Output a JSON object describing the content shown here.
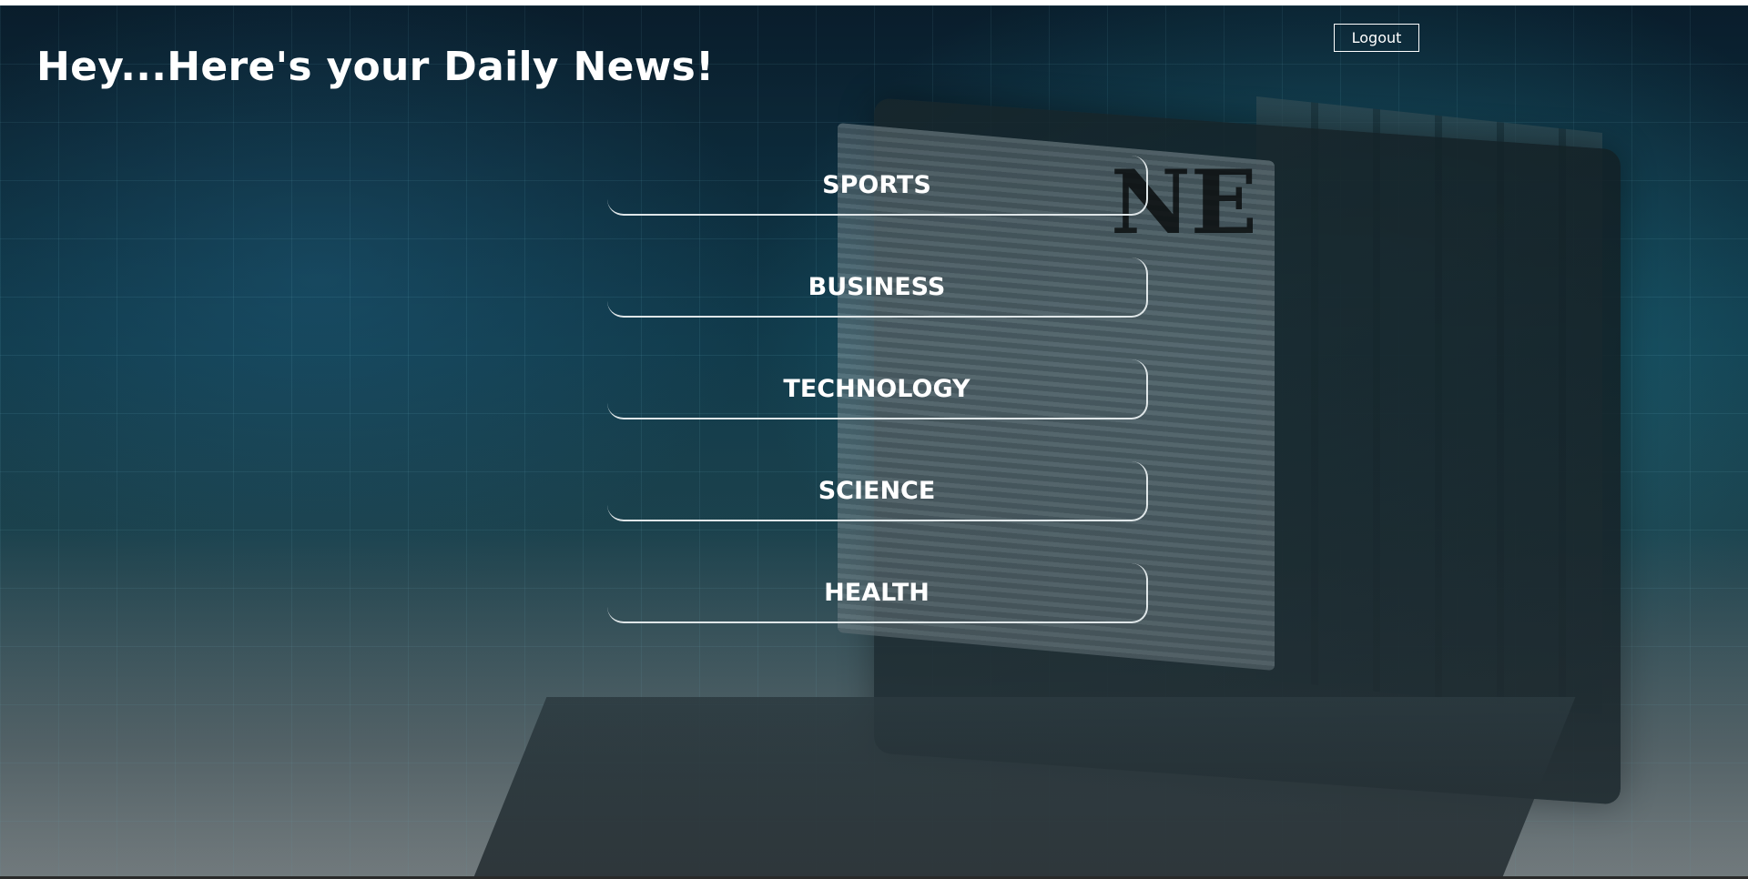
{
  "header": {
    "title": "Hey...Here's your Daily News!",
    "logout_label": "Logout"
  },
  "categories": [
    {
      "label": "SPORTS"
    },
    {
      "label": "BUSINESS"
    },
    {
      "label": "TECHNOLOGY"
    },
    {
      "label": "SCIENCE"
    },
    {
      "label": "HEALTH"
    }
  ],
  "background": {
    "newspaper_heading": "NE"
  },
  "colors": {
    "text": "#ffffff",
    "button_border": "#dfe6e8",
    "background_dark": "#0b2233",
    "background_accent": "#17414d"
  }
}
